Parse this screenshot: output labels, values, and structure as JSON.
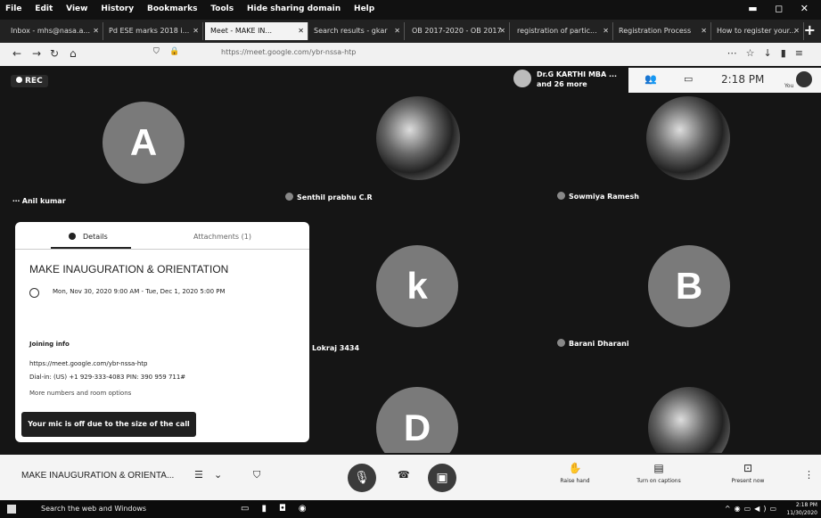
{
  "browser": {
    "menu": [
      "File",
      "Edit",
      "View",
      "History",
      "Bookmarks",
      "Tools",
      "Hide sharing domain",
      "Help"
    ],
    "tabs": [
      {
        "label": "Inbox - mhs@nasa.a..."
      },
      {
        "label": "Pd ESE marks 2018 i..."
      },
      {
        "label": "Meet - MAKE IN..."
      },
      {
        "label": "Search results - gkar"
      },
      {
        "label": "OB 2017-2020 - OB 2017"
      },
      {
        "label": "registration of partic..."
      },
      {
        "label": "Registration Process"
      },
      {
        "label": "How to register your..."
      }
    ],
    "url": "https://meet.google.com/ybr-nssa-htp"
  },
  "meet": {
    "rec": "REC",
    "presenter": [
      "Dr.G KARTHI MBA ...",
      "and 26 more"
    ],
    "time": "2:18 PM",
    "you": "You",
    "participants": [
      {
        "initial": "A",
        "name": "Anil kumar"
      },
      {
        "initial": "",
        "name": "Senthil prabhu C.R"
      },
      {
        "initial": "",
        "name": "Sowmiya Ramesh"
      },
      {
        "initial": "k",
        "name": "Lokraj 3434"
      },
      {
        "initial": "B",
        "name": "Barani Dharani"
      },
      {
        "initial": "D",
        "name": ""
      },
      {
        "initial": "",
        "name": ""
      }
    ],
    "details": {
      "tab_details": "Details",
      "tab_attachments": "Attachments (1)",
      "title": "MAKE INAUGURATION & ORIENTATION",
      "when": "Mon, Nov 30, 2020 9:00 AM - Tue, Dec 1, 2020 5:00 PM",
      "joining_heading": "Joining info",
      "link": "https://meet.google.com/ybr-nssa-htp",
      "dial": "Dial-in: (US) +1 929-333-4083  PIN: 390 959 711#",
      "more": "More numbers and room options"
    },
    "toast": "Your mic is off due to the size of the call",
    "bottom": {
      "meeting_title": "MAKE INAUGURATION & ORIENTA...",
      "raise_hand": "Raise hand",
      "captions": "Turn on captions",
      "present": "Present now"
    }
  },
  "taskbar": {
    "search": "Search the web and Windows",
    "time": "2:18 PM",
    "date": "11/30/2020"
  }
}
